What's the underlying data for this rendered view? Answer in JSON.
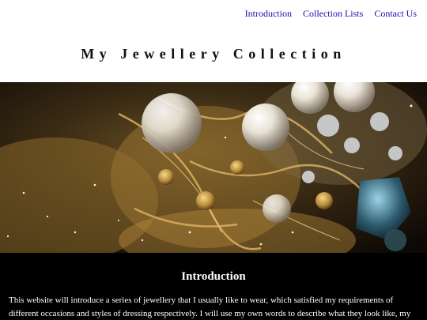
{
  "nav": {
    "items": [
      "Introduction",
      "Collection Lists",
      "Contact Us"
    ]
  },
  "header": {
    "title": "My Jewellery Collection"
  },
  "hero": {
    "icon": "jewellery-photo"
  },
  "intro": {
    "heading": "Introduction",
    "text": "This website will introduce a series of jewellery that I usually like to wear, which satisfied my requirements of different occasions and styles of dressing respectively. I will use my own words to describe what they look like, my story with"
  },
  "colors": {
    "link": "#1a0dab",
    "intro_bg": "#000000",
    "intro_text": "#ffffff"
  }
}
